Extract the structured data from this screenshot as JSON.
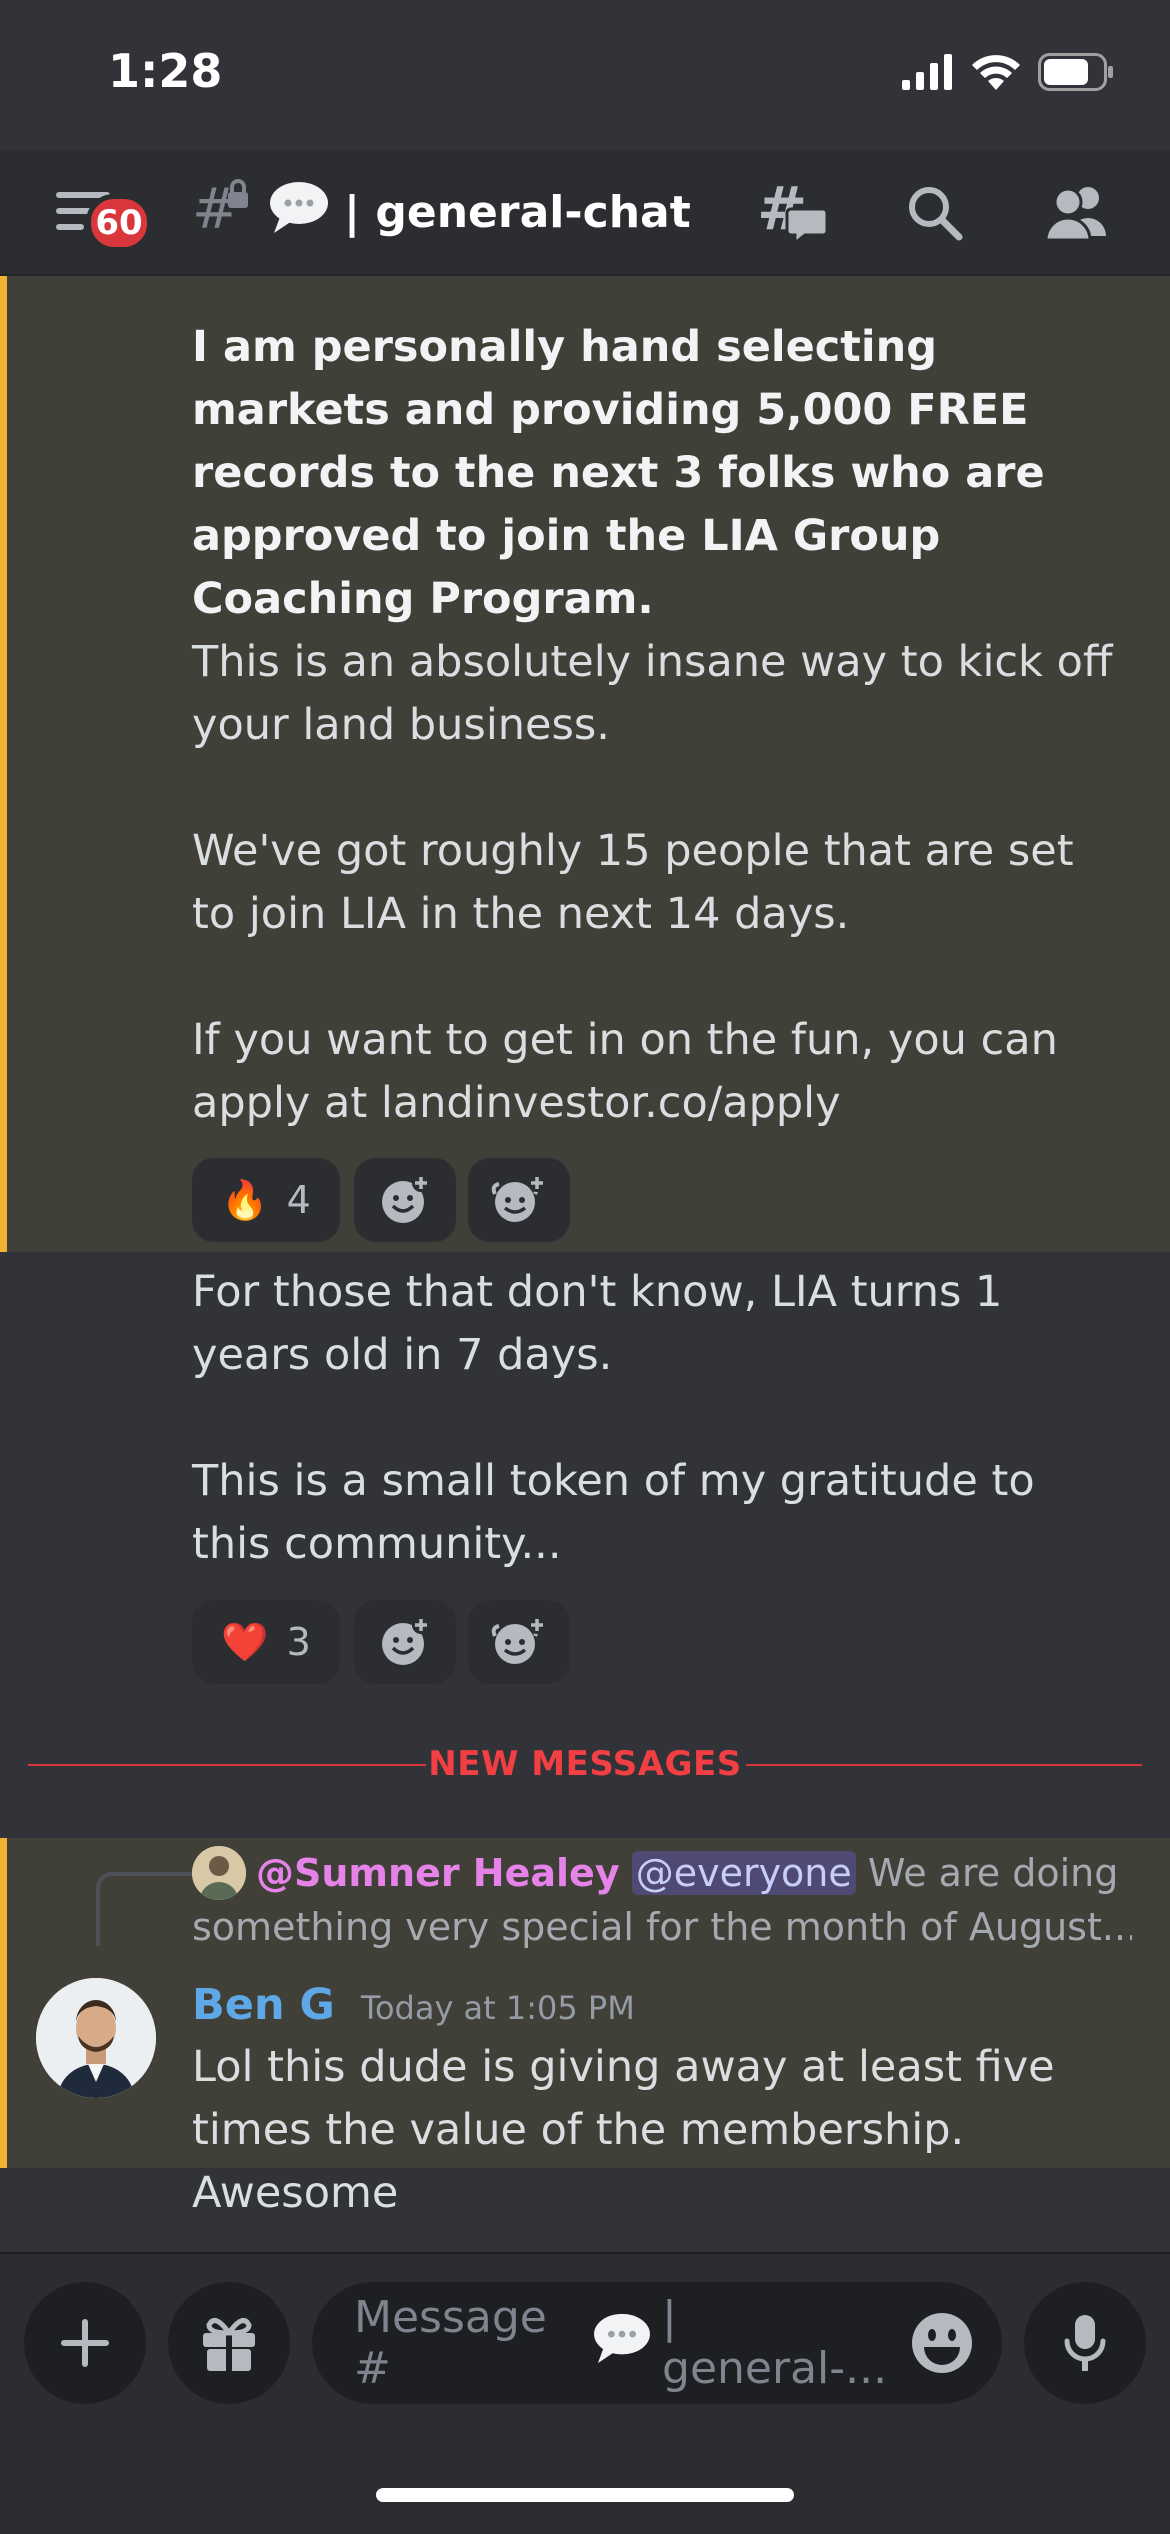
{
  "status_bar": {
    "time": "1:28"
  },
  "header": {
    "badge": "60",
    "channel_name": "| general-chat"
  },
  "message1": {
    "bold_text": "I am personally hand selecting markets and providing 5,000 FREE records to the next 3 folks who are approved to join the LIA Group Coaching Program.",
    "para2": "This is an absolutely insane way to kick off your land business.",
    "para3": "We've got roughly 15 people that are set to join LIA in the next 14 days.",
    "para4": "If you want to get in on the fun, you can apply at landinvestor.co/apply",
    "reaction": {
      "emoji": "🔥",
      "count": "4"
    }
  },
  "message2": {
    "para1": "For those that don't know, LIA turns 1 years old in 7 days.",
    "para2": "This is a small token of my gratitude to this community...",
    "reaction": {
      "emoji": "❤️",
      "count": "3"
    }
  },
  "divider": {
    "label": "NEW MESSAGES"
  },
  "reply": {
    "reply_author": "@Sumner Healey",
    "mention": "@everyone",
    "preview_line1": "We are doing",
    "preview_line2": "something very special for the month of August...  I...",
    "author": "Ben G",
    "timestamp": "Today at 1:05 PM",
    "text": "Lol this dude is giving away at least five times the value of the membership. Awesome"
  },
  "composer": {
    "placeholder_prefix": "Message #",
    "placeholder_suffix": "| general-..."
  },
  "colors": {
    "background": "#313338",
    "header": "#2b2d31",
    "highlight": "#403f38",
    "highlight_bar": "#f0b232",
    "author_name": "#5ea8e8",
    "mention_author": "#e583e8",
    "new_messages": "#f23f43"
  }
}
